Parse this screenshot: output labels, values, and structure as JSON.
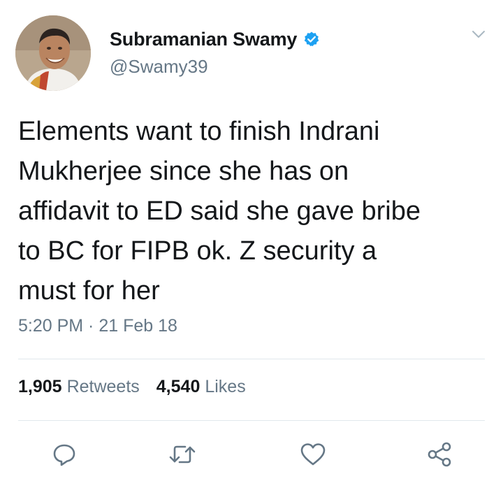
{
  "author": {
    "display_name": "Subramanian Swamy",
    "handle": "@Swamy39",
    "verified": true
  },
  "tweet": {
    "text": "Elements want to finish Indrani\nMukherjee since she has on\naffidavit to ED said she gave bribe\nto BC for FIPB ok. Z security a\nmust for her",
    "timestamp": "5:20 PM · 21 Feb 18"
  },
  "stats": {
    "retweets_count": "1,905",
    "retweets_label": "Retweets",
    "likes_count": "4,540",
    "likes_label": "Likes"
  },
  "actions": [
    {
      "icon": "reply-icon"
    },
    {
      "icon": "retweet-icon"
    },
    {
      "icon": "like-icon"
    },
    {
      "icon": "share-icon"
    }
  ],
  "colors": {
    "text": "#14171a",
    "secondary": "#657786",
    "verified": "#1da1f2",
    "divider": "#e1e8ed"
  }
}
